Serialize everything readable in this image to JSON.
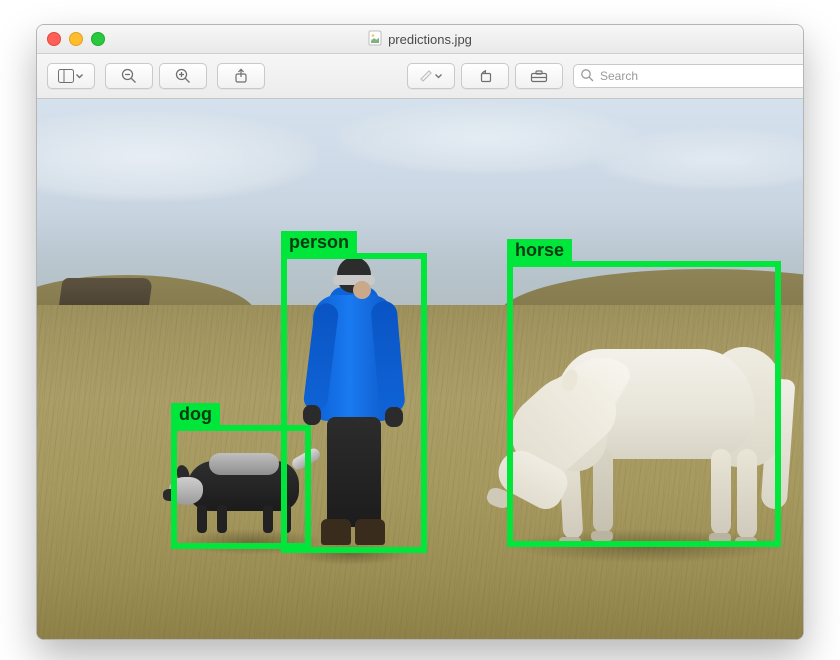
{
  "window": {
    "title": "predictions.jpg"
  },
  "toolbar": {
    "search_placeholder": "Search"
  },
  "detections": {
    "dog": {
      "label": "dog"
    },
    "person": {
      "label": "person"
    },
    "horse": {
      "label": "horse"
    }
  }
}
